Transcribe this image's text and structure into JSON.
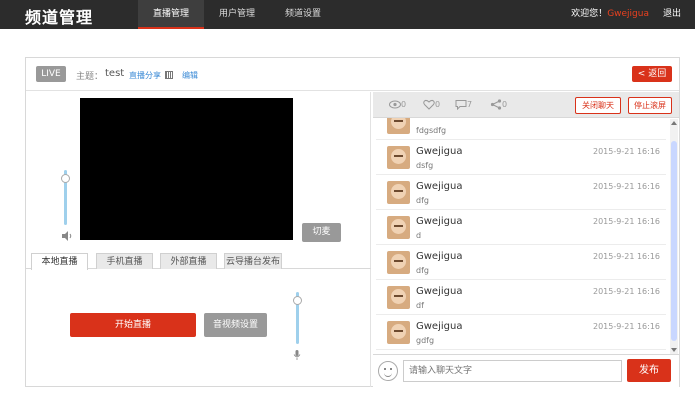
{
  "header": {
    "logo": "频道管理",
    "nav": [
      {
        "label": "直播管理",
        "active": true
      },
      {
        "label": "用户管理",
        "active": false
      },
      {
        "label": "频道设置",
        "active": false
      }
    ],
    "welcome_prefix": "欢迎您！",
    "username": "Gwejigua",
    "logout": "退出"
  },
  "panel": {
    "live_badge": "LIVE",
    "topic_label": "主题：",
    "topic_value": "test",
    "share_link": "直播分享",
    "edit_link": "编辑",
    "back_button": "< 返回"
  },
  "player": {
    "switch_button": "切麦",
    "tabs": [
      {
        "label": "本地直播",
        "active": true
      },
      {
        "label": "手机直播",
        "active": false
      },
      {
        "label": "外部直播",
        "active": false
      },
      {
        "label": "云导播台发布",
        "active": false
      }
    ],
    "start_button": "开始直播",
    "av_settings_button": "音视频设置",
    "volume_level": 0.85,
    "mic_level": 0.85
  },
  "chat": {
    "stats": {
      "views": "0",
      "likes": "0",
      "comments": "7",
      "shares": "0"
    },
    "close_chat_button": "关闭聊天",
    "stop_scroll_button": "停止滚屏",
    "messages": [
      {
        "name": "",
        "text": "fdgsdfg",
        "time": ""
      },
      {
        "name": "Gwejigua",
        "text": "dsfg",
        "time": "2015-9-21 16:16"
      },
      {
        "name": "Gwejigua",
        "text": "dfg",
        "time": "2015-9-21 16:16"
      },
      {
        "name": "Gwejigua",
        "text": "d",
        "time": "2015-9-21 16:16"
      },
      {
        "name": "Gwejigua",
        "text": "dfg",
        "time": "2015-9-21 16:16"
      },
      {
        "name": "Gwejigua",
        "text": "df",
        "time": "2015-9-21 16:16"
      },
      {
        "name": "Gwejigua",
        "text": "gdfg",
        "time": "2015-9-21 16:16"
      }
    ],
    "input_placeholder": "请输入聊天文字",
    "send_button": "发布"
  }
}
